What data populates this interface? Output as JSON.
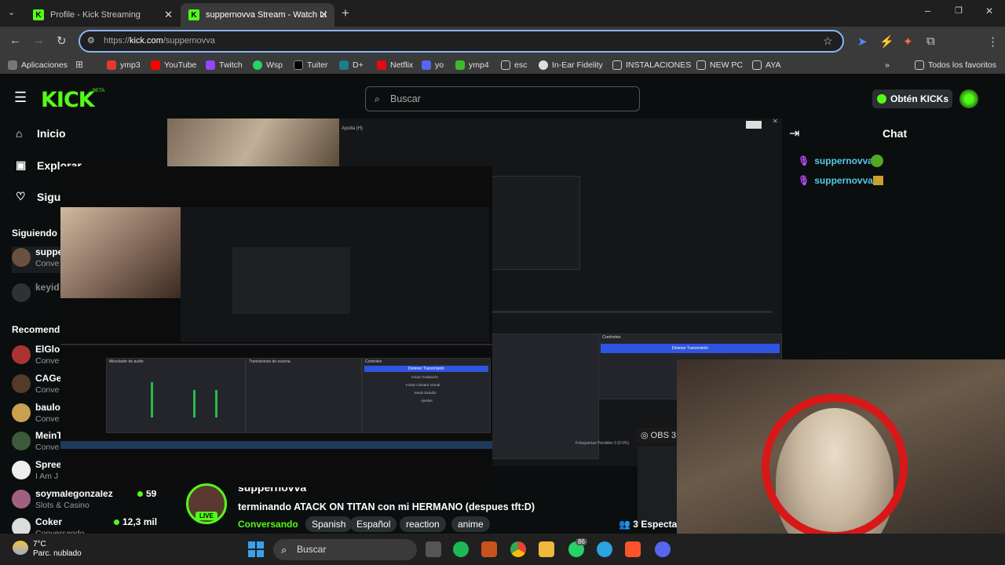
{
  "browser": {
    "tabs": [
      {
        "title": "Profile - Kick Streaming"
      },
      {
        "title": "suppernovva Stream - Watch Li"
      }
    ],
    "url": "https://kick.com/suppernovva",
    "url_host": "kick.com",
    "url_path": "/suppernovva",
    "bookmarks": [
      {
        "label": "Aplicaciones"
      },
      {
        "label": "ymp3"
      },
      {
        "label": "YouTube"
      },
      {
        "label": "Twitch"
      },
      {
        "label": "Wsp"
      },
      {
        "label": "Tuiter"
      },
      {
        "label": "D+"
      },
      {
        "label": "Netflix"
      },
      {
        "label": "yo"
      },
      {
        "label": "ymp4"
      },
      {
        "label": "esc"
      },
      {
        "label": "In-Ear Fidelity"
      },
      {
        "label": "INSTALACIONES"
      },
      {
        "label": "NEW PC"
      },
      {
        "label": "AYA"
      }
    ],
    "all_bookmarks": "Todos los favoritos",
    "overflow": "»"
  },
  "kick": {
    "logo": "KICK",
    "beta": "BETA",
    "search_placeholder": "Buscar",
    "get_kicks": "Obtén KICKs",
    "nav": [
      {
        "label": "Inicio"
      },
      {
        "label": "Explorar"
      },
      {
        "label": "Sigui"
      }
    ],
    "following_header": "Siguiendo",
    "following": [
      {
        "name": "suppe",
        "category": "Conve"
      },
      {
        "name": "keyid",
        "category": ""
      }
    ],
    "recommended_header": "Recomend",
    "recommended": [
      {
        "name": "ElGlo",
        "category": "Conve"
      },
      {
        "name": "CAGe",
        "category": "Conve"
      },
      {
        "name": "baulo",
        "category": "Conve"
      },
      {
        "name": "MeinT",
        "category": "Conve"
      },
      {
        "name": "Spree",
        "category": "I Am J"
      },
      {
        "name": "soymalegonzalez",
        "category": "Slots & Casino",
        "viewers": "59"
      },
      {
        "name": "Coker",
        "category": "Conversando",
        "viewers": "12,3 mil"
      }
    ],
    "stream": {
      "channel": "suppernovva",
      "live": "LIVE",
      "title": "terminando ATACK ON TITAN con mi HERMANO (despues tft:D)",
      "category": "Conversando",
      "tags": [
        "Spanish",
        "Español",
        "reaction",
        "anime"
      ],
      "viewers": "3",
      "viewers_suffix": "Espectad"
    },
    "chat": {
      "title": "Chat",
      "messages": [
        {
          "user": "suppernovva:"
        },
        {
          "user": "suppernovva:"
        }
      ]
    }
  },
  "obs": {
    "help_menu": "Ayuda (H)",
    "controls_header": "Controles",
    "stop_stream": "Detener Transmisión",
    "frames_dropped": "Fotogramas Perdidos 0 (0.0%)",
    "obs_label": "OBS 3",
    "audio_mixer": "Mezclador de audio",
    "transitions": "Transiciones de escena",
    "controls_small": "Controles",
    "stop_small": "Detener Transmisión",
    "start_record": "Iniciar Grabación",
    "virtual_cam": "Iniciar Cámara Virtual",
    "studio_mode": "Modo Estudio",
    "settings": "Ajustes"
  },
  "taskbar": {
    "temp": "7°C",
    "weather": "Parc. nublado",
    "search": "Buscar",
    "whatsapp_badge": "86"
  }
}
